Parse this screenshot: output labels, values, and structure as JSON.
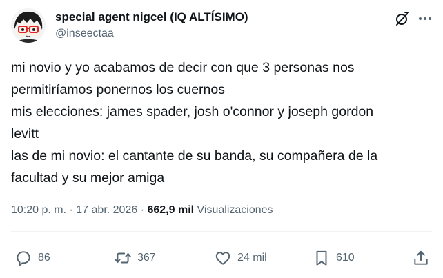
{
  "author": {
    "display_name": "special agent nigcel (IQ ALTÍSIMO)",
    "handle": "@inseectaa",
    "avatar_icon": "anime-avatar-with-red-glasses"
  },
  "header_actions": {
    "grok_icon": "grok-icon",
    "more_icon": "more-horizontal-icon"
  },
  "tweet": {
    "lines": [
      "mi novio y yo acabamos de decir con que 3 personas nos",
      "permitiríamos ponernos los cuernos",
      "mis elecciones: james spader, josh o'connor y joseph gordon",
      "levitt",
      "las de mi novio: el cantante de su banda, su compañera de la",
      "facultad y su mejor amiga"
    ]
  },
  "meta": {
    "time": "10:20 p. m.",
    "separator": "·",
    "date": "17 abr. 2026",
    "views_count": "662,9 mil",
    "views_label": "Visualizaciones"
  },
  "actions": {
    "replies": "86",
    "retweets": "367",
    "likes": "24 mil",
    "bookmarks": "610"
  },
  "colors": {
    "text": "#0f1419",
    "secondary": "#536471",
    "divider": "#eff3f4",
    "avatar_glasses": "#e0242e"
  }
}
